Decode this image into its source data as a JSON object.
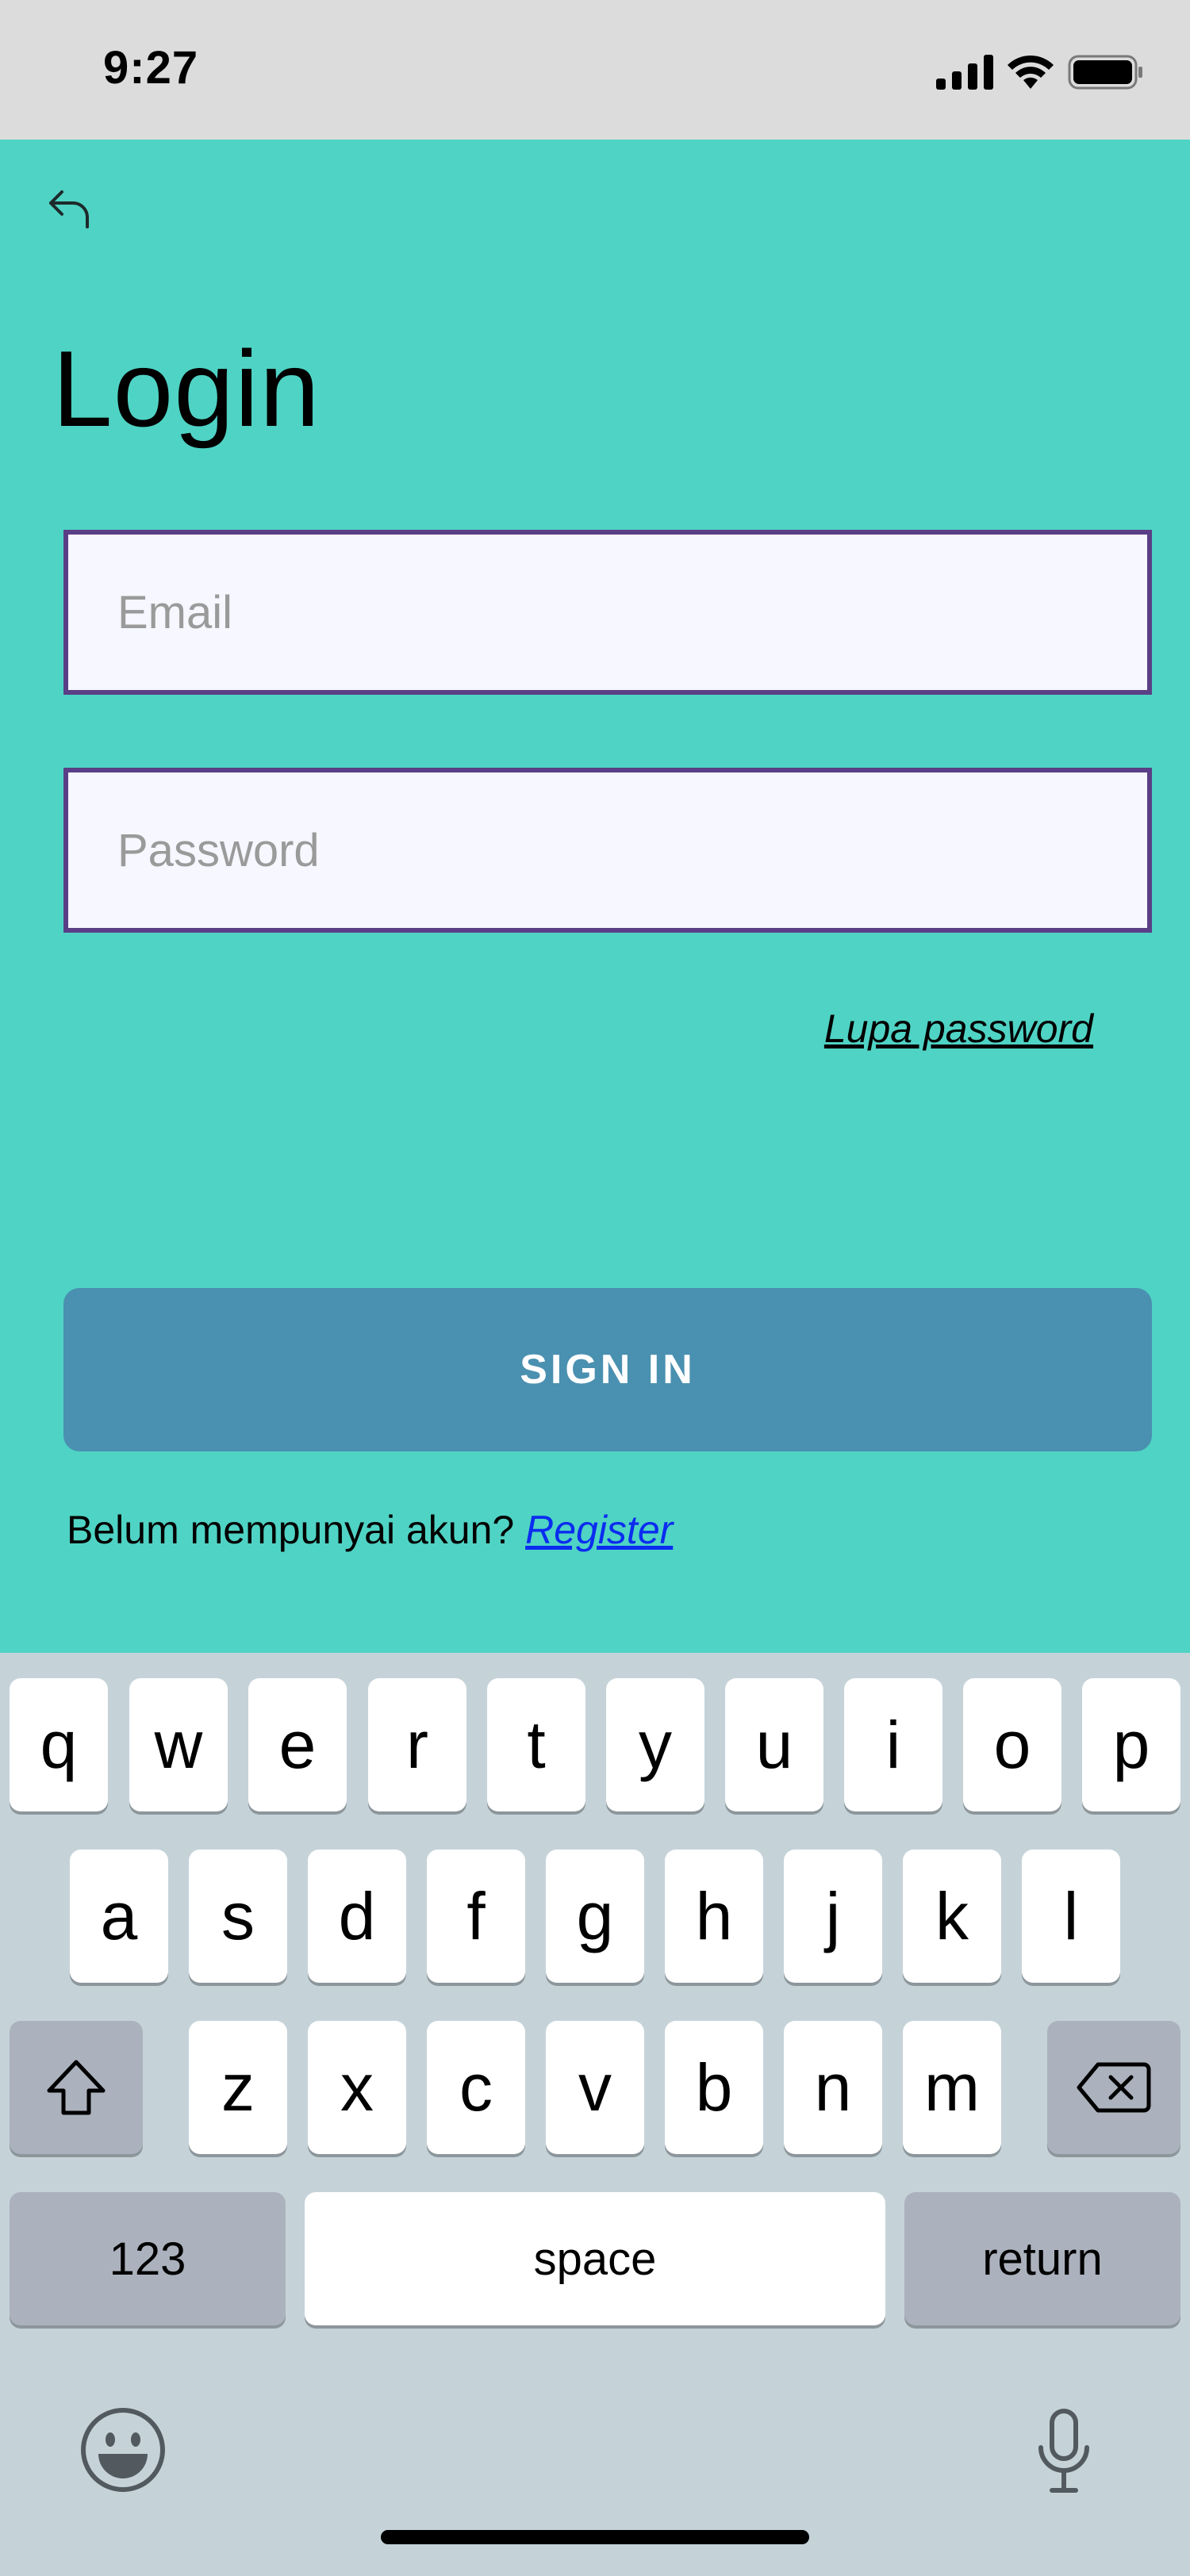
{
  "status_bar": {
    "time": "9:27"
  },
  "screen": {
    "title": "Login",
    "email_placeholder": "Email",
    "password_placeholder": "Password",
    "forgot_password": "Lupa password",
    "sign_in": "SIGN IN",
    "register_prompt": "Belum mempunyai akun?",
    "register_link": "Register"
  },
  "colors": {
    "background": "#4fd3c4",
    "field_border": "#5a3f86",
    "field_fill": "#f6f7ff",
    "button": "#4a90b0",
    "link": "#0b2cf0"
  },
  "keyboard": {
    "row1": [
      "q",
      "w",
      "e",
      "r",
      "t",
      "y",
      "u",
      "i",
      "o",
      "p"
    ],
    "row2": [
      "a",
      "s",
      "d",
      "f",
      "g",
      "h",
      "j",
      "k",
      "l"
    ],
    "row3": [
      "z",
      "x",
      "c",
      "v",
      "b",
      "n",
      "m"
    ],
    "numbers_key": "123",
    "space_key": "space",
    "return_key": "return"
  }
}
